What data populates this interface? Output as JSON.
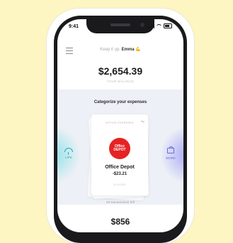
{
  "status_bar": {
    "time": "9:41"
  },
  "header": {
    "greeting_prefix": "Keep it up,",
    "user_name": "Emma",
    "emoji": "💪"
  },
  "balance": {
    "amount": "$2,654.39",
    "label": "YOUR BALANCE"
  },
  "categorize": {
    "title": "Categorize your expenses",
    "left_category": "LIFE",
    "right_category": "WORK",
    "card": {
      "category": "OFFICE EXPENSES",
      "logo_text": "Office DEPOT",
      "merchant": "Office Depot",
      "amount": "-$23.21",
      "date": "10.10.2019"
    },
    "remaining": "26 transactions left"
  },
  "next_section": {
    "amount": "$856"
  },
  "colors": {
    "background": "#fdf5c2",
    "logo_red": "#e52323",
    "life_accent": "#2aa9b3",
    "work_accent": "#6a6ad8"
  }
}
